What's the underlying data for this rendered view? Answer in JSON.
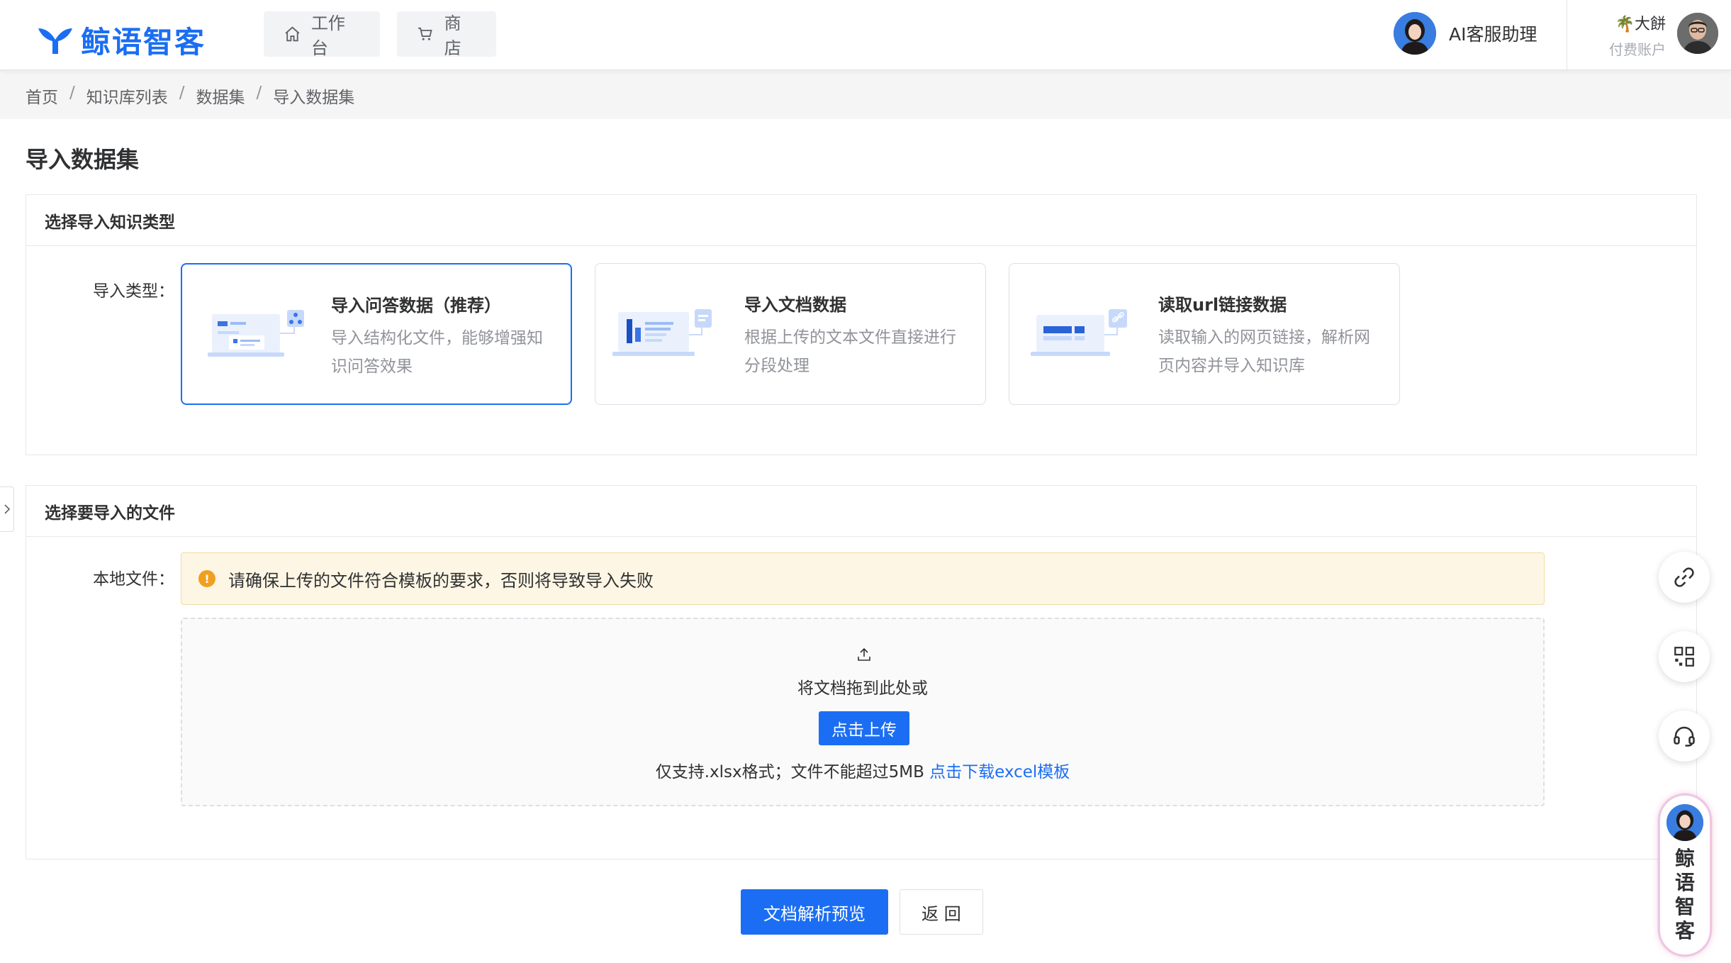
{
  "header": {
    "brand": "鲸语智客",
    "nav": [
      {
        "label": "工作台",
        "icon": "home-icon"
      },
      {
        "label": "商店",
        "icon": "cart-icon"
      }
    ],
    "assistant_label": "AI客服助理",
    "user_name": "大餅",
    "user_plan": "付费账户"
  },
  "breadcrumb": [
    "首页",
    "知识库列表",
    "数据集",
    "导入数据集"
  ],
  "page": {
    "title": "导入数据集",
    "section1": {
      "title": "选择导入知识类型",
      "label": "导入类型：",
      "types": [
        {
          "title": "导入问答数据（推荐）",
          "desc": "导入结构化文件，能够增强知识问答效果",
          "selected": true
        },
        {
          "title": "导入文档数据",
          "desc": "根据上传的文本文件直接进行分段处理",
          "selected": false
        },
        {
          "title": "读取url链接数据",
          "desc": "读取输入的网页链接，解析网页内容并导入知识库",
          "selected": false
        }
      ]
    },
    "section2": {
      "title": "选择要导入的文件",
      "label": "本地文件：",
      "alert": "请确保上传的文件符合模板的要求，否则将导致导入失败",
      "upload_hint": "将文档拖到此处或",
      "upload_button": "点击上传",
      "upload_tip": "仅支持.xlsx格式；文件不能超过5MB",
      "download_link": "点击下载excel模板"
    },
    "actions": {
      "preview": "文档解析预览",
      "back": "返 回"
    }
  },
  "floating": {
    "brand_text": "鲸语智客",
    "buttons": [
      "link-icon",
      "qrcode-icon",
      "headset-icon"
    ]
  },
  "colors": {
    "primary": "#1b6ef3",
    "alert_bg": "#fdf6e4",
    "warning": "#f0a020"
  }
}
